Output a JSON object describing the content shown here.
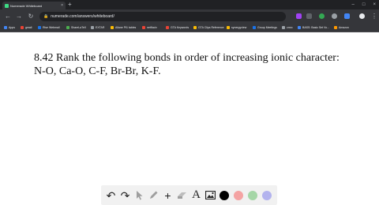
{
  "browser": {
    "tab_title": "Numerade Whiteboard",
    "tab_close": "×",
    "new_tab": "+",
    "window_controls": [
      "–",
      "□",
      "×"
    ],
    "nav": {
      "back": "←",
      "forward": "→",
      "reload": "↻"
    },
    "lock": "🔒",
    "url": "numerade.com/answers/whiteboard/",
    "menu": "⋮",
    "bookmarks": [
      {
        "label": "Apps",
        "color": "#4285f4"
      },
      {
        "label": "gmail",
        "color": "#ea4335"
      },
      {
        "label": "Rise Webmail",
        "color": "#1a73e8"
      },
      {
        "label": "ShareLaTeX",
        "color": "#4caf50"
      },
      {
        "label": "EXTAR",
        "color": "#9aa0a6"
      },
      {
        "label": "Allane Pt1 tables",
        "color": "#fbbc04"
      },
      {
        "label": "netflociv",
        "color": "#ea4335"
      },
      {
        "label": "GTA Keywords",
        "color": "#ea4335"
      },
      {
        "label": "GTA Clips Reference",
        "color": "#fbbc04"
      },
      {
        "label": "synergyview",
        "color": "#fbbc04"
      },
      {
        "label": "Group Meetings",
        "color": "#1a73e8"
      },
      {
        "label": "cmrc",
        "color": "#9aa0a6"
      },
      {
        "label": "BASS: Basic Set Vo...",
        "color": "#4285f4"
      },
      {
        "label": "Amazon",
        "color": "#ff9900"
      }
    ]
  },
  "problem": {
    "line1": "8.42 Rank the following bonds in order of increasing ionic character:",
    "line2": "N-O, Ca-O, C-F, Br-Br, K-F."
  },
  "whiteboard_tools": {
    "undo": "↶",
    "redo": "↷",
    "text_tool": "A",
    "add": "+",
    "colors": {
      "black": "#000000",
      "red": "#f4a3a3",
      "green": "#a5d6a7",
      "purple": "#b3b3ee"
    }
  }
}
